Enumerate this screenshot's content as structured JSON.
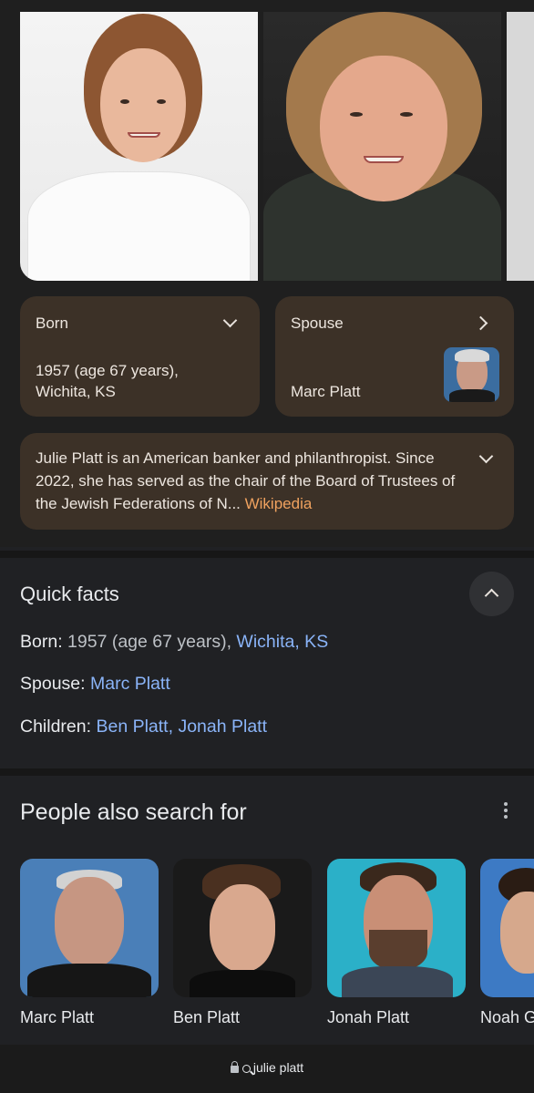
{
  "images": [
    {
      "alt": "Julie Platt photo 1"
    },
    {
      "alt": "Julie Platt photo 2"
    }
  ],
  "born_card": {
    "label": "Born",
    "value_line1": "1957 (age 67 years),",
    "value_line2": "Wichita, KS"
  },
  "spouse_card": {
    "label": "Spouse",
    "value": "Marc Platt"
  },
  "description": {
    "text": "Julie Platt is an American banker and philanthropist. Since 2022, she has served as the chair of the Board of Trustees of the Jewish Federations of N... ",
    "source": "Wikipedia"
  },
  "quick_facts": {
    "title": "Quick facts",
    "born_key": "Born",
    "born_value": " 1957 (age 67 years), ",
    "born_link": "Wichita, KS",
    "spouse_key": "Spouse",
    "spouse_link": "Marc Platt",
    "children_key": "Children",
    "children_link1": "Ben Platt",
    "children_link2": "Jonah Platt"
  },
  "people_also_search": {
    "title": "People also search for",
    "people": [
      {
        "name": "Marc Platt"
      },
      {
        "name": "Ben Platt"
      },
      {
        "name": "Jonah Platt"
      },
      {
        "name": "Noah G"
      }
    ]
  },
  "address_bar": {
    "url": "julie platt"
  },
  "colors": {
    "card_bg": "#3c3127",
    "link": "#8ab4f8",
    "wiki": "#f0a25f"
  }
}
